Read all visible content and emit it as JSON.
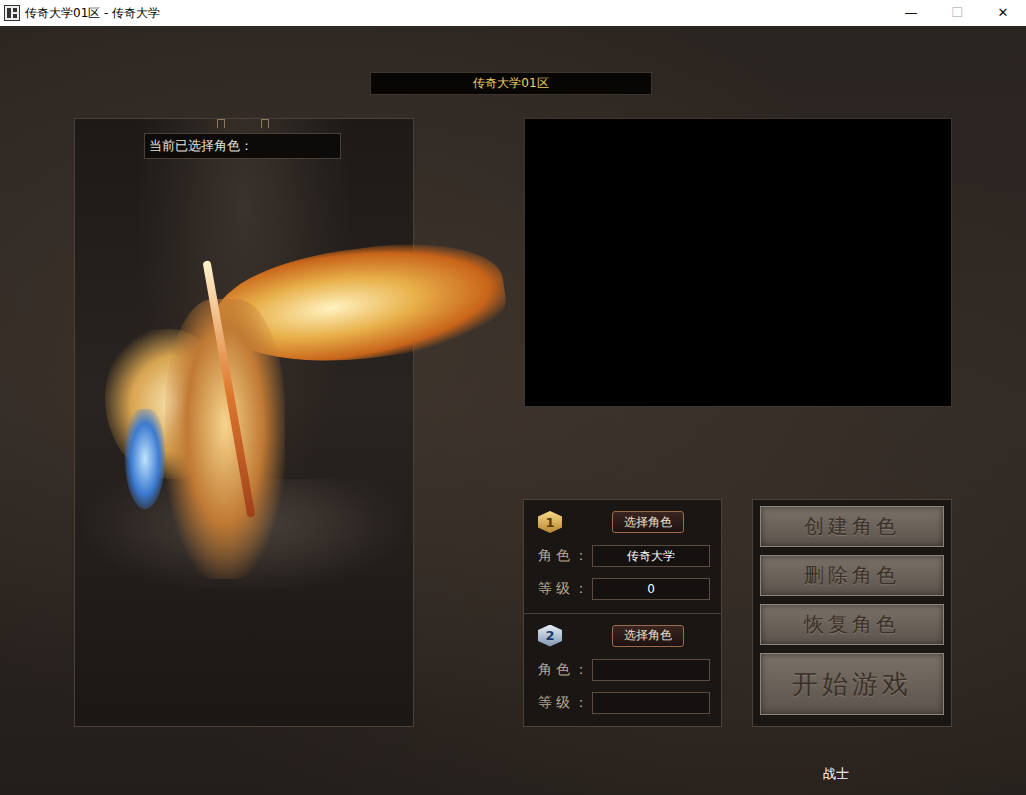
{
  "window": {
    "title": "传奇大学01区 - 传奇大学",
    "controls": [
      "—",
      "☐",
      "✕"
    ]
  },
  "server": {
    "name": "传奇大学01区"
  },
  "current": {
    "label": "当前已选择角色："
  },
  "slots": [
    {
      "number": "1",
      "kind": "gold",
      "button": "选择角色",
      "role_label": "角色：",
      "role": "传奇大学",
      "level_label": "等级：",
      "level": "0"
    },
    {
      "number": "2",
      "kind": "silver",
      "button": "选择角色",
      "role_label": "角色：",
      "role": "",
      "level_label": "等级：",
      "level": ""
    }
  ],
  "actions": [
    {
      "label": "创建角色",
      "kind": "normal"
    },
    {
      "label": "删除角色",
      "kind": "normal"
    },
    {
      "label": "恢复角色",
      "kind": "normal"
    },
    {
      "label": "开始游戏",
      "kind": "primary"
    }
  ],
  "class_name": "战士"
}
